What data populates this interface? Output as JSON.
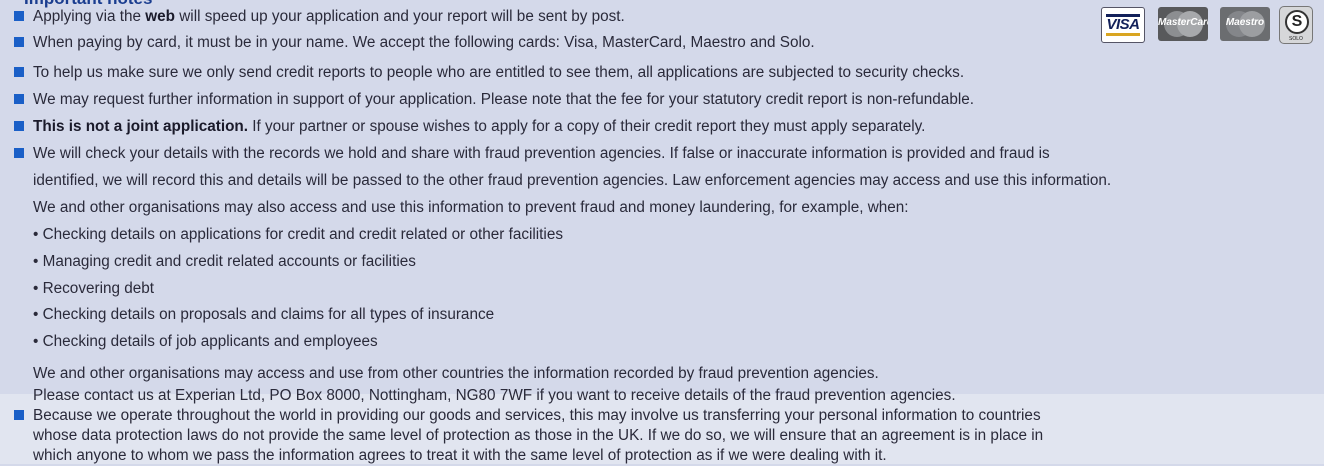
{
  "heading": "Important notes",
  "items": [
    {
      "pre": "Applying via the ",
      "bold": "web",
      "post": " will speed up your application and your report will be sent by post."
    },
    {
      "text": "When paying by card, it must be in your name. We accept the following cards: Visa, MasterCard, Maestro and Solo."
    },
    {
      "text": "To help us make sure we only send credit reports to people who are entitled to see them, all applications are subjected to security checks."
    },
    {
      "text": "We may request further information in support of your application. Please note that the fee for your statutory credit report is non-refundable."
    },
    {
      "bold": "This is not a joint application.",
      "post": " If your partner or spouse wishes to apply for a copy of their credit report they must apply separately."
    },
    {
      "lines": [
        "We will check your details with the records we hold and share with fraud prevention agencies. If false or inaccurate information is provided and fraud is",
        "identified, we will record this and details will be passed to the other fraud prevention agencies. Law enforcement agencies may access and use this information.",
        "We and other organisations may also access and use this information to prevent fraud and money laundering, for example, when:"
      ]
    }
  ],
  "sub_bullets": [
    "• Checking details on applications for credit and credit related or other facilities",
    "• Managing credit and credit related accounts or facilities",
    "• Recovering debt",
    "• Checking details on proposals and claims for all types of insurance",
    "• Checking details of job applicants and employees"
  ],
  "follow_lines": [
    "We and other organisations may access and use from other countries the information recorded by fraud prevention agencies.",
    "Please contact us at Experian Ltd, PO Box 8000, Nottingham, NG80 7WF if you want to receive details of the fraud prevention agencies."
  ],
  "last_item_lines": [
    "Because we operate throughout the world in providing our goods and services, this may involve us transferring your personal information to countries",
    "whose data protection laws do not provide the same level of protection as those in the UK. If we do so, we will ensure that an agreement is in place in",
    "which anyone to whom we pass the information agrees to treat it with the same level of protection as if we were dealing with it."
  ],
  "cards": {
    "visa": "VISA",
    "mastercard": "MasterCard",
    "maestro": "Maestro",
    "solo_symbol": "S",
    "solo": "SOLO"
  },
  "colors": {
    "bullet": "#1a5fc7",
    "background": "#d4d9ea",
    "heading": "#1a3d8f"
  }
}
